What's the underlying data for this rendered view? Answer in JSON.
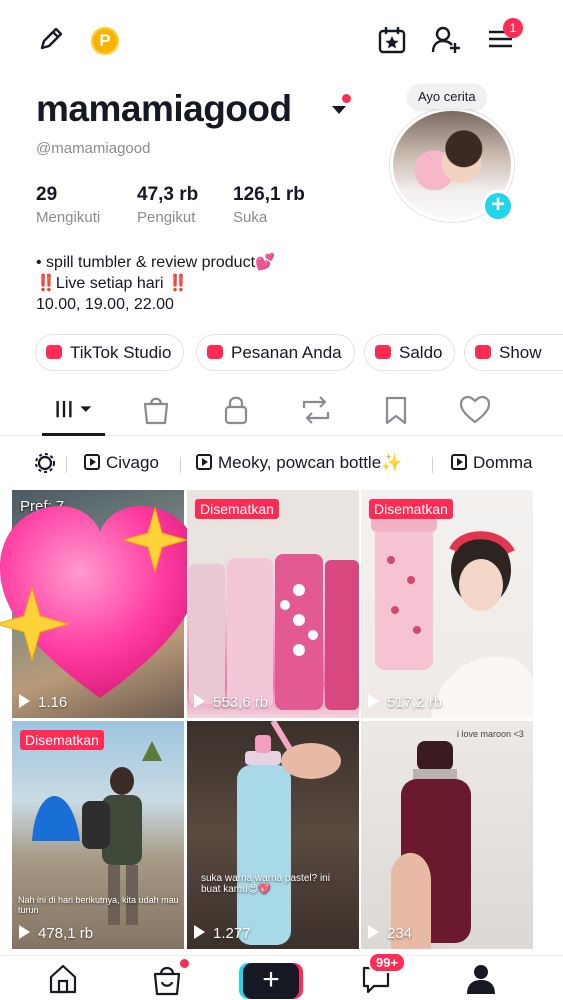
{
  "header": {
    "coin_label": "P",
    "menu_badge": "1"
  },
  "profile": {
    "username": "mamamiagood",
    "handle": "@mamamiagood",
    "story_prompt": "Ayo cerita",
    "stats": [
      {
        "num": "29",
        "label": "Mengikuti"
      },
      {
        "num": "47,3 rb",
        "label": "Pengikut"
      },
      {
        "num": "126,1 rb",
        "label": "Suka"
      }
    ],
    "bio": [
      "• spill tumbler & review product💕",
      "‼️Live setiap hari ‼️",
      "10.00, 19.00, 22.00"
    ]
  },
  "pills": [
    "TikTok Studio",
    "Pesanan Anda",
    "Saldo",
    "Show"
  ],
  "categories": [
    "Civago",
    "Meoky, powcan bottle✨",
    "Domma"
  ],
  "videos": [
    {
      "badge": "",
      "views": "1.16",
      "overlay": "Pref: 7",
      "caption": ""
    },
    {
      "badge": "Disematkan",
      "views": "553,6 rb",
      "overlay": "",
      "caption": ""
    },
    {
      "badge": "Disematkan",
      "views": "517,2 rb",
      "overlay": "",
      "caption": ""
    },
    {
      "badge": "Disematkan",
      "views": "478,1 rb",
      "overlay": "",
      "caption": "Nah ini di hari berikutnya, kita udah mau turun"
    },
    {
      "badge": "",
      "views": "1.277",
      "overlay": "",
      "caption": "suka warna warna pastel? ini buat kamu😍💖"
    },
    {
      "badge": "",
      "views": "234",
      "overlay": "",
      "caption": "i love maroon <3"
    }
  ],
  "bottom_nav": {
    "inbox_badge": "99+",
    "create_label": "+"
  },
  "colors": {
    "accent": "#fe2c55",
    "cyan": "#20d5ec",
    "text": "#161823",
    "muted": "#8a8b91"
  }
}
